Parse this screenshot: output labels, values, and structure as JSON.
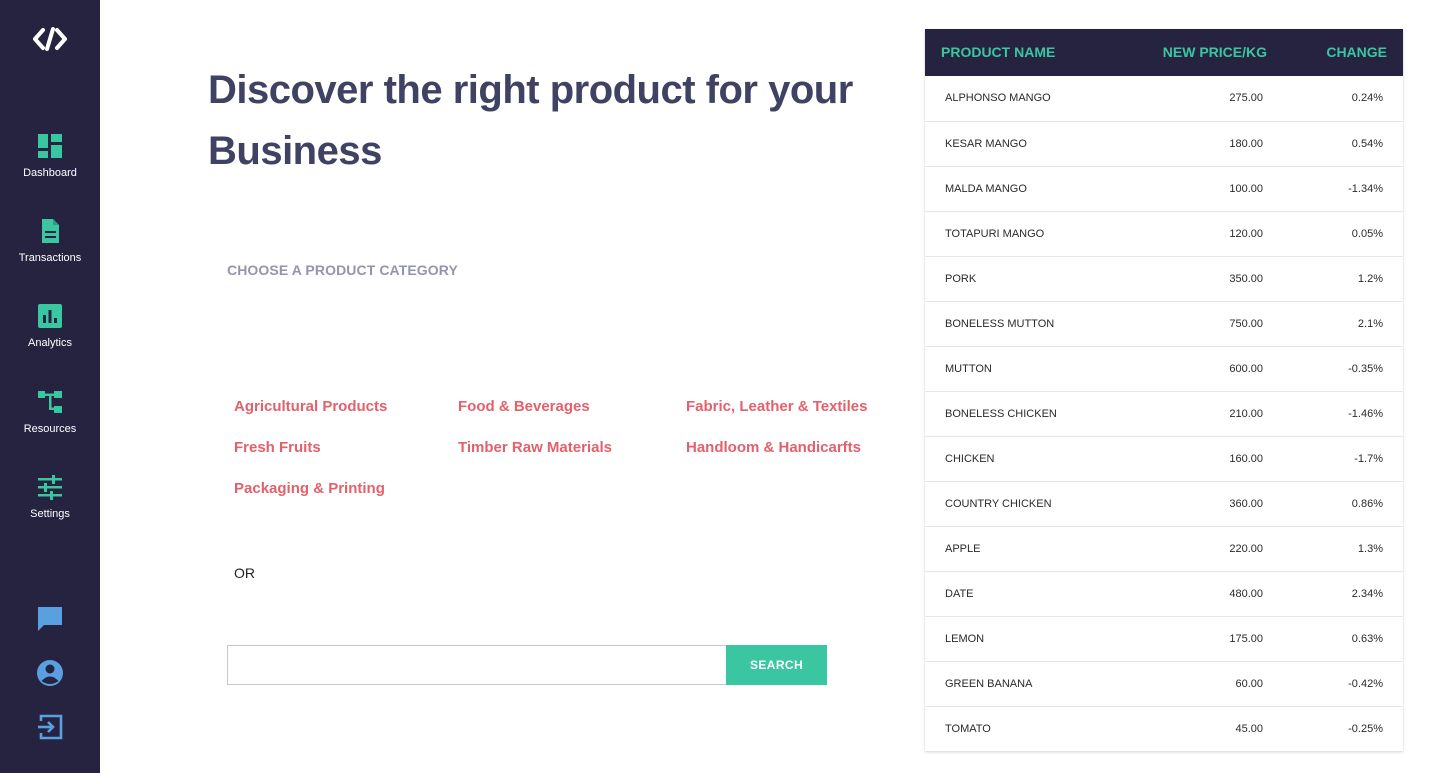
{
  "sidebar": {
    "nav": [
      {
        "label": "Dashboard",
        "icon": "dashboard-icon"
      },
      {
        "label": "Transactions",
        "icon": "document-icon"
      },
      {
        "label": "Analytics",
        "icon": "bar-chart-icon"
      },
      {
        "label": "Resources",
        "icon": "tree-structure-icon"
      },
      {
        "label": "Settings",
        "icon": "sliders-icon"
      }
    ],
    "bottom_icons": [
      "chat-icon",
      "account-icon",
      "logout-icon"
    ]
  },
  "main": {
    "headline": "Discover the right product for your Business",
    "choose_label": "CHOOSE A PRODUCT CATEGORY",
    "categories": [
      "Agricultural Products",
      "Food & Beverages",
      "Fabric, Leather & Textiles",
      "Fresh Fruits",
      "Timber Raw Materials",
      "Handloom & Handicarfts",
      "Packaging & Printing"
    ],
    "or_text": "OR",
    "search": {
      "value": "",
      "placeholder": "",
      "button_label": "SEARCH"
    }
  },
  "prices": {
    "headers": {
      "name": "PRODUCT NAME",
      "price": "NEW PRICE/KG",
      "change": "CHANGE"
    },
    "rows": [
      {
        "name": "ALPHONSO MANGO",
        "price": "275.00",
        "change": "0.24%"
      },
      {
        "name": "KESAR MANGO",
        "price": "180.00",
        "change": "0.54%"
      },
      {
        "name": "MALDA MANGO",
        "price": "100.00",
        "change": "-1.34%"
      },
      {
        "name": "TOTAPURI MANGO",
        "price": "120.00",
        "change": "0.05%"
      },
      {
        "name": "PORK",
        "price": "350.00",
        "change": "1.2%"
      },
      {
        "name": "BONELESS MUTTON",
        "price": "750.00",
        "change": "2.1%"
      },
      {
        "name": "MUTTON",
        "price": "600.00",
        "change": "-0.35%"
      },
      {
        "name": "BONELESS CHICKEN",
        "price": "210.00",
        "change": "-1.46%"
      },
      {
        "name": "CHICKEN",
        "price": "160.00",
        "change": "-1.7%"
      },
      {
        "name": "COUNTRY CHICKEN",
        "price": "360.00",
        "change": "0.86%"
      },
      {
        "name": "APPLE",
        "price": "220.00",
        "change": "1.3%"
      },
      {
        "name": "DATE",
        "price": "480.00",
        "change": "2.34%"
      },
      {
        "name": "LEMON",
        "price": "175.00",
        "change": "0.63%"
      },
      {
        "name": "GREEN BANANA",
        "price": "60.00",
        "change": "-0.42%"
      },
      {
        "name": "TOMATO",
        "price": "45.00",
        "change": "-0.25%"
      }
    ]
  },
  "colors": {
    "sidebar_bg": "#262340",
    "accent": "#3ac6a0",
    "category_link": "#e2616b",
    "headline": "#3f4262",
    "bottom_icon": "#5aa0e0"
  }
}
